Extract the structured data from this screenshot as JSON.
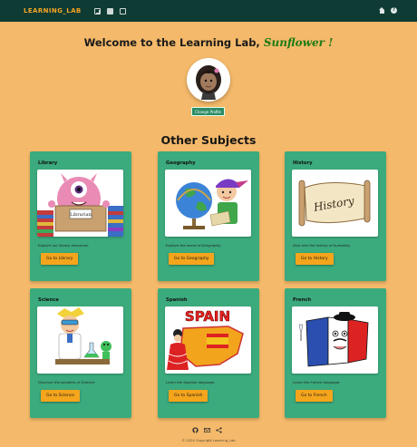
{
  "navbar": {
    "brand": "LEARNING_LAB",
    "left_icons": [
      "grid-icon",
      "letter-icon",
      "image-icon"
    ],
    "right_icons": [
      "home-icon",
      "help-icon"
    ],
    "help_glyph": "?"
  },
  "welcome": {
    "prefix": "Welcome to the Learning Lab, ",
    "username": "Sunflower !"
  },
  "profile": {
    "change_label": "Change Profile"
  },
  "section_title": "Other Subjects",
  "subjects": [
    {
      "title": "Library",
      "description": "Explore our library resources.",
      "button": "Go to Library",
      "image_icon": "library-monster-image",
      "image_label": "Librarian"
    },
    {
      "title": "Geography",
      "description": "Explore the world of Geography.",
      "button": "Go to Geography",
      "image_icon": "globe-boy-image"
    },
    {
      "title": "History",
      "description": "Dive into the history of humanity.",
      "button": "Go to History",
      "image_icon": "history-scroll-image",
      "image_label": "History"
    },
    {
      "title": "Science",
      "description": "Discover the wonders of Science.",
      "button": "Go to Science",
      "image_icon": "scientist-image"
    },
    {
      "title": "Spanish",
      "description": "Learn the Spanish language.",
      "button": "Go to Spanish",
      "image_icon": "spain-map-image",
      "image_label": "SPAIN"
    },
    {
      "title": "French",
      "description": "Learn the French language.",
      "button": "Go to French",
      "image_icon": "french-flag-image"
    }
  ],
  "footer": {
    "icons": [
      "github-icon",
      "mail-icon",
      "share-icon"
    ],
    "copyright": "© 2024 Copyright Learning_Lab"
  },
  "colors": {
    "background": "#f4b96a",
    "navbar": "#0f3b35",
    "brand": "#f5a623",
    "card": "#3baa7c",
    "button": "#f5a51c",
    "username": "#1e7a16"
  }
}
